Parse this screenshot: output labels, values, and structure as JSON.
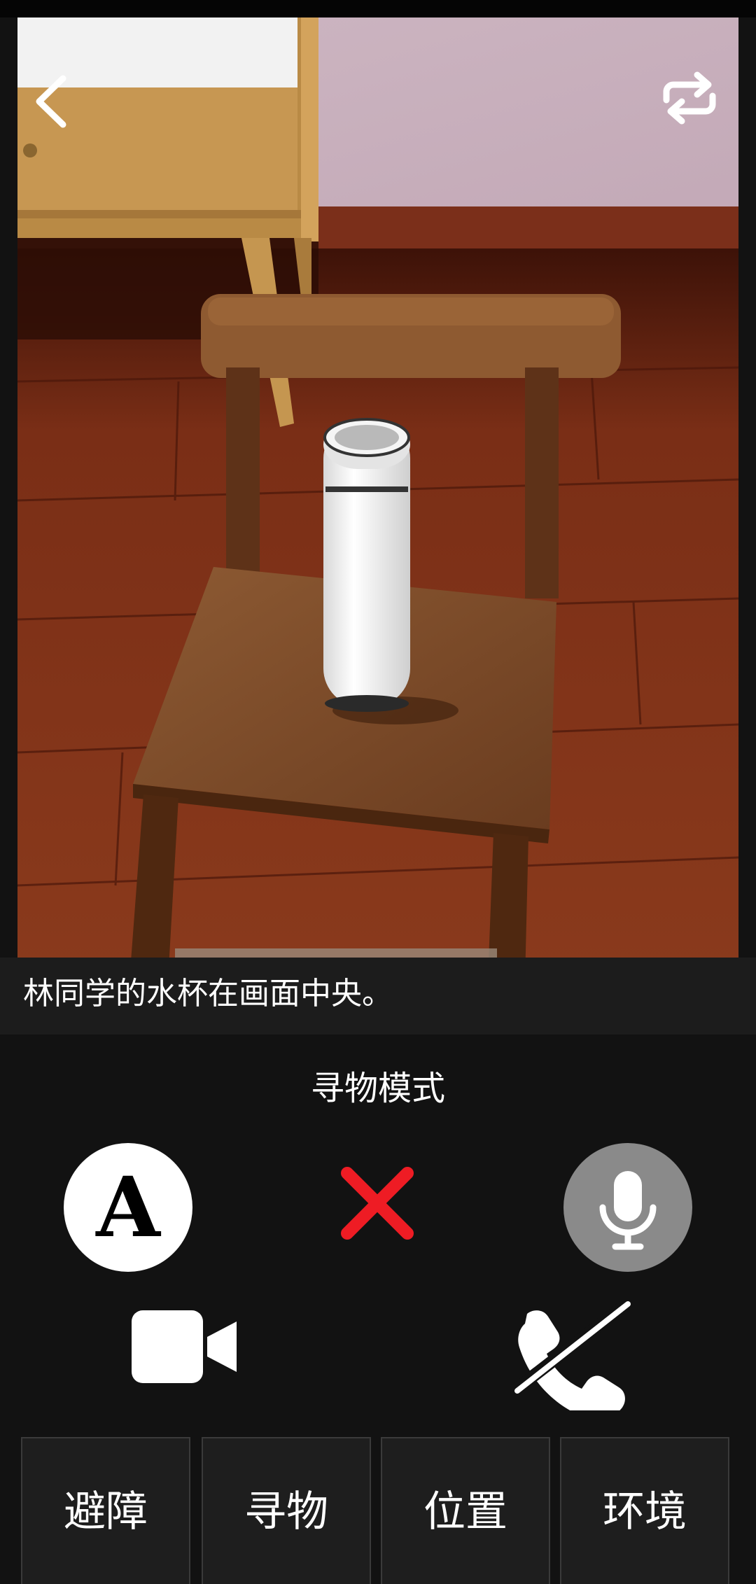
{
  "caption": {
    "text": "林同学的水杯在画面中央。"
  },
  "mode": {
    "label": "寻物模式"
  },
  "font_button": {
    "glyph": "A"
  },
  "icons": {
    "back": "chevron-left-icon",
    "switch_camera": "camera-switch-icon",
    "font": "font-size-icon",
    "close": "close-x-icon",
    "mic": "microphone-icon",
    "video": "video-camera-icon",
    "hangup": "phone-off-icon"
  },
  "tabs": [
    {
      "label": "避障"
    },
    {
      "label": "寻物"
    },
    {
      "label": "位置"
    },
    {
      "label": "环境"
    }
  ],
  "colors": {
    "background": "#121212",
    "close_red": "#ee1c24",
    "mic_gray": "#8a8a8a",
    "white": "#ffffff"
  }
}
